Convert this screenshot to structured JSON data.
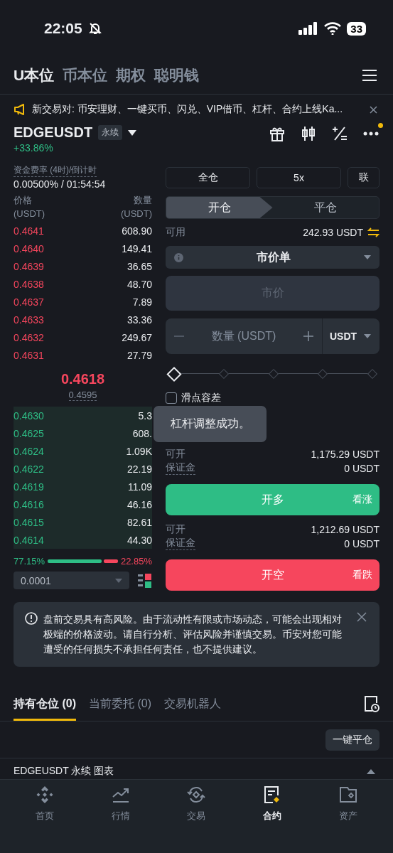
{
  "status_bar": {
    "time": "22:05",
    "battery": "33"
  },
  "top_tabs": [
    {
      "label": "U本位",
      "selected": true
    },
    {
      "label": "币本位",
      "selected": false
    },
    {
      "label": "期权",
      "selected": false
    },
    {
      "label": "聪明钱",
      "selected": false
    }
  ],
  "announcement": "新交易对: 币安理财、一键买币、闪兑、VIP借币、杠杆、合约上线Ka...",
  "symbol": {
    "name": "EDGEUSDT",
    "tag": "永续",
    "change": "+33.86%",
    "has_notification": true
  },
  "funding": {
    "label": "资金费率 (4时)/倒计时",
    "value": "0.00500% / 01:54:54"
  },
  "order_book": {
    "price_header": "价格",
    "price_unit": "(USDT)",
    "qty_header": "数量",
    "qty_unit": "(USDT)",
    "asks": [
      {
        "price": "0.4641",
        "qty": "608.90"
      },
      {
        "price": "0.4640",
        "qty": "149.41"
      },
      {
        "price": "0.4639",
        "qty": "36.65"
      },
      {
        "price": "0.4638",
        "qty": "48.70"
      },
      {
        "price": "0.4637",
        "qty": "7.89"
      },
      {
        "price": "0.4633",
        "qty": "33.36"
      },
      {
        "price": "0.4632",
        "qty": "249.67"
      },
      {
        "price": "0.4631",
        "qty": "27.79"
      }
    ],
    "last_price": "0.4618",
    "mark_price": "0.4595",
    "bids": [
      {
        "price": "0.4630",
        "qty": "5.3"
      },
      {
        "price": "0.4625",
        "qty": "608."
      },
      {
        "price": "0.4624",
        "qty": "1.09K"
      },
      {
        "price": "0.4622",
        "qty": "22.19"
      },
      {
        "price": "0.4619",
        "qty": "11.09"
      },
      {
        "price": "0.4616",
        "qty": "46.16"
      },
      {
        "price": "0.4615",
        "qty": "82.61"
      },
      {
        "price": "0.4614",
        "qty": "44.30"
      }
    ],
    "buy_ratio": {
      "label": "77.15%",
      "level": 0.7715
    },
    "sell_ratio": "22.85%",
    "precision": "0.0001"
  },
  "order_form": {
    "margin_mode": "全仓",
    "leverage": "5x",
    "asset_mode": "联",
    "position_tabs": [
      {
        "label": "开仓",
        "selected": true
      },
      {
        "label": "平仓",
        "selected": false
      }
    ],
    "available_label": "可用",
    "available": "242.93 USDT",
    "order_type": "市价单",
    "price_field": {
      "value": "市价",
      "disabled": true
    },
    "quantity_placeholder": "数量 (USDT)",
    "quantity_unit": "USDT",
    "slider": {
      "level": 0
    },
    "slippage": {
      "label": "滑点容差",
      "checked": false
    },
    "long": {
      "max_label": "可开",
      "max": "1,175.29 USDT",
      "margin_label": "保证金",
      "margin": "0 USDT",
      "button": "开多",
      "hint": "看涨"
    },
    "short": {
      "max_label": "可开",
      "max": "1,212.69 USDT",
      "margin_label": "保证金",
      "margin": "0 USDT",
      "button": "开空",
      "hint": "看跌"
    }
  },
  "toast": "杠杆调整成功。",
  "risk_notice": "盘前交易具有高风险。由于流动性有限或市场动态，可能会出现相对极端的价格波动。请自行分析、评估风险并谨慎交易。币安对您可能遭受的任何损失不承担任何责任，也不提供建议。",
  "position_tabs": [
    {
      "label": "持有仓位 (0)",
      "selected": true
    },
    {
      "label": "当前委托 (0)",
      "selected": false
    },
    {
      "label": "交易机器人",
      "selected": false
    }
  ],
  "close_all": "一键平仓",
  "chart_section": "EDGEUSDT 永续 图表",
  "nav": [
    {
      "label": "首页",
      "selected": false
    },
    {
      "label": "行情",
      "selected": false
    },
    {
      "label": "交易",
      "selected": false
    },
    {
      "label": "合约",
      "selected": true
    },
    {
      "label": "资产",
      "selected": false
    }
  ]
}
